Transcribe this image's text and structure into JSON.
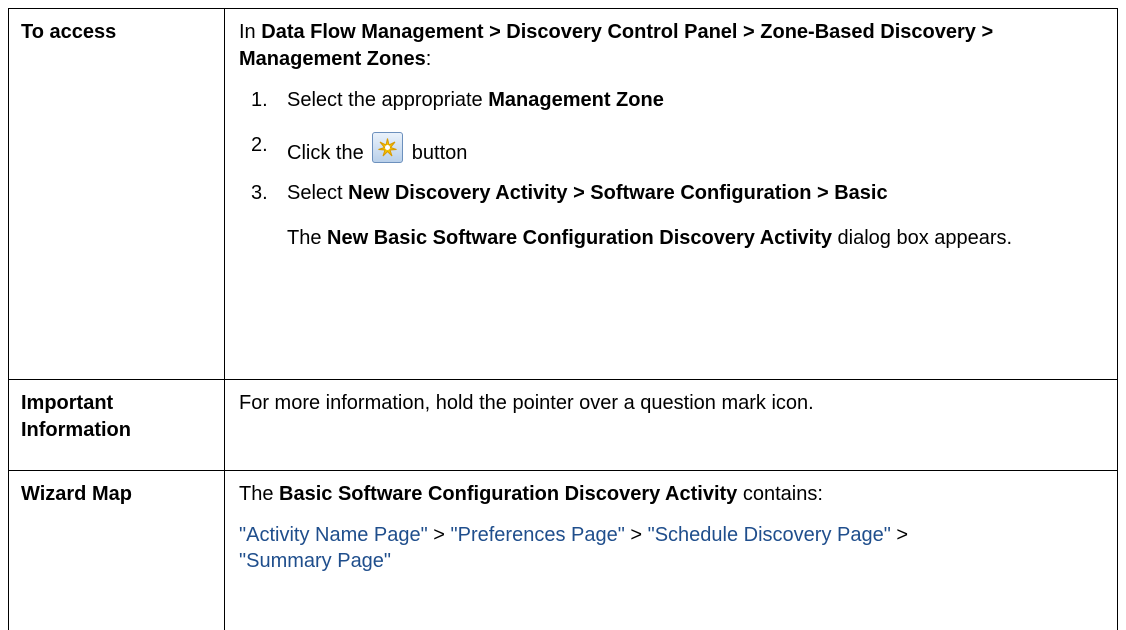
{
  "access": {
    "header": "To access",
    "intro_prefix": "In ",
    "intro_path": "Data Flow Management > Discovery Control Panel > Zone-Based Discovery > Management Zones",
    "intro_suffix": ":",
    "steps": [
      {
        "number": "1.",
        "text_before": "Select the appropriate ",
        "bold": "Management Zone"
      },
      {
        "number": "2.",
        "text_before": "Click the ",
        "icon": "new-asterisk-icon",
        "text_after": " button"
      },
      {
        "number": "3.",
        "text_before": "Select ",
        "bold": "New Discovery Activity > Software Configuration > Basic"
      }
    ],
    "note_prefix": "The ",
    "note_bold": "New Basic Software Configuration Discovery Activity",
    "note_suffix": " dialog box appears."
  },
  "important": {
    "header": "Important Information",
    "text": "For more information, hold the pointer over a question mark icon."
  },
  "wizard_map": {
    "header": "Wizard Map",
    "intro_prefix": "The ",
    "intro_bold": "Basic Software Configuration Discovery Activity",
    "intro_suffix": " contains:",
    "links": [
      "\"Activity Name Page\"",
      "\"Preferences Page\"",
      "\"Schedule Discovery Page\"",
      "\"Summary Page\""
    ],
    "separator": " > "
  },
  "colors": {
    "link": "#1f4e8c",
    "border": "#000000",
    "icon_fill": "#f5c400"
  }
}
